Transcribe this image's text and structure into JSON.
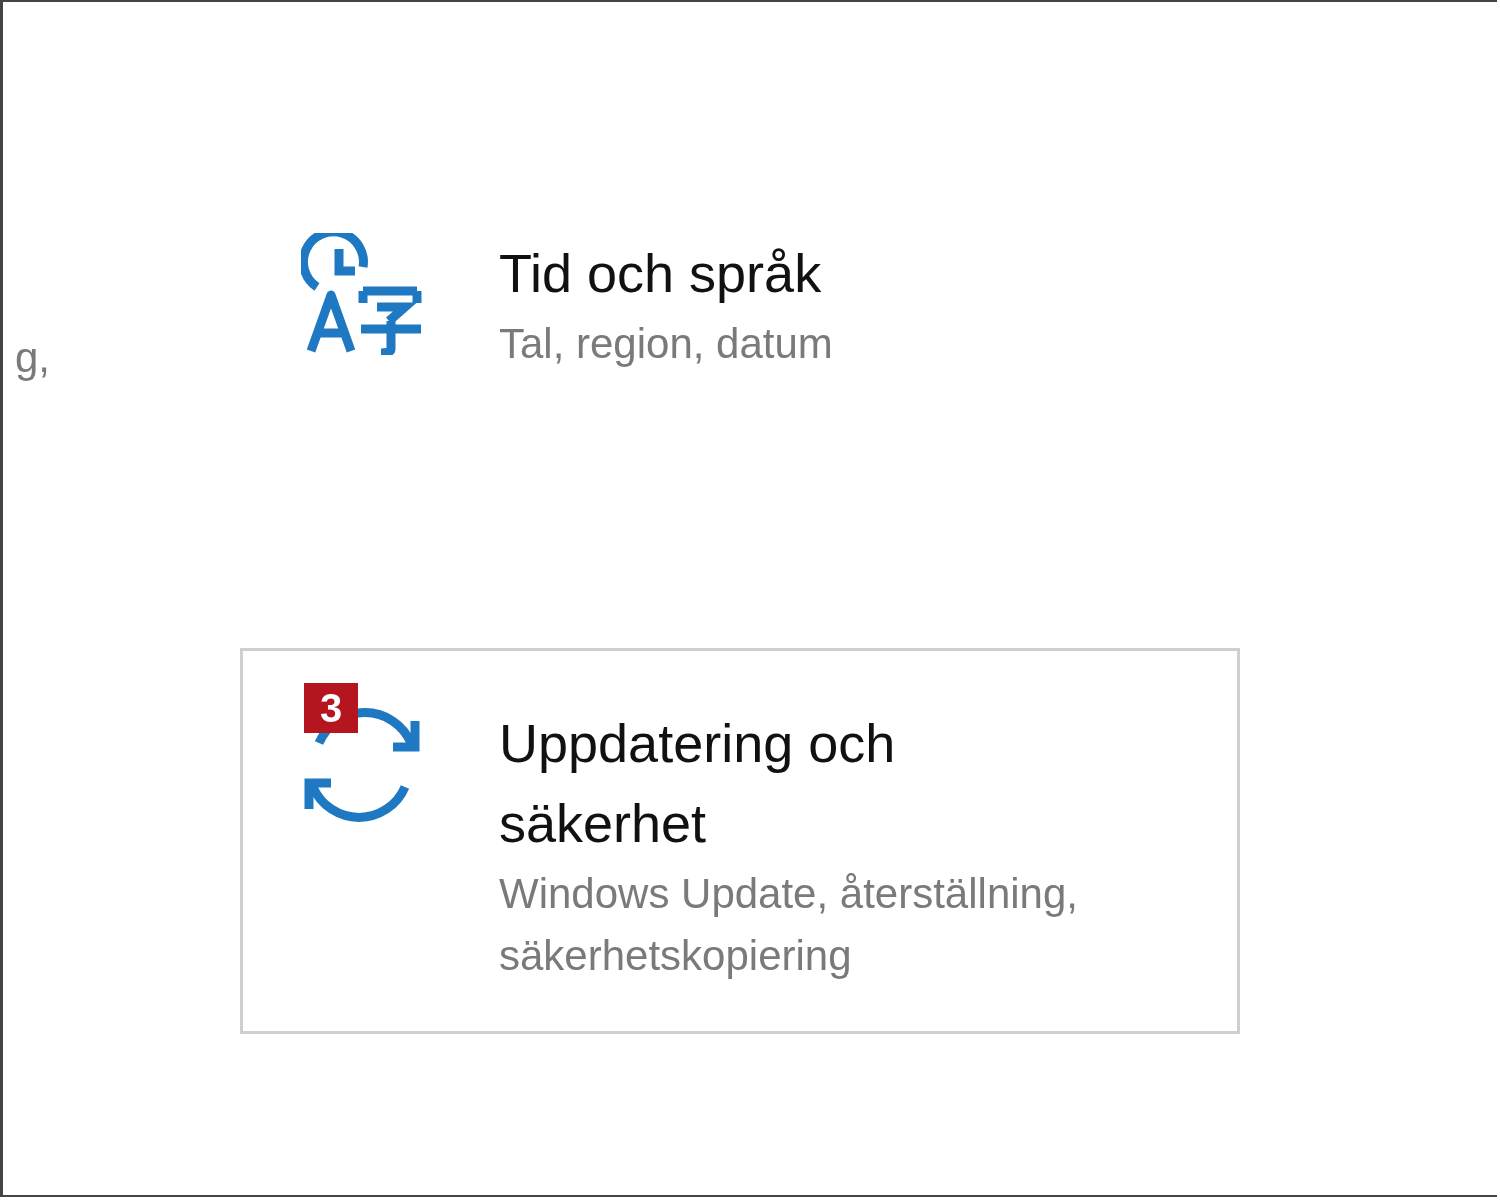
{
  "partial_text": "g,",
  "tiles": [
    {
      "kind": "time-language",
      "title": "Tid och språk",
      "subtitle": "Tal, region, datum",
      "focused": false
    },
    {
      "kind": "update",
      "title": "Uppdatering och säkerhet",
      "subtitle": "Windows Update, återställning, säkerhetskopiering",
      "focused": true,
      "badge": "3"
    }
  ]
}
